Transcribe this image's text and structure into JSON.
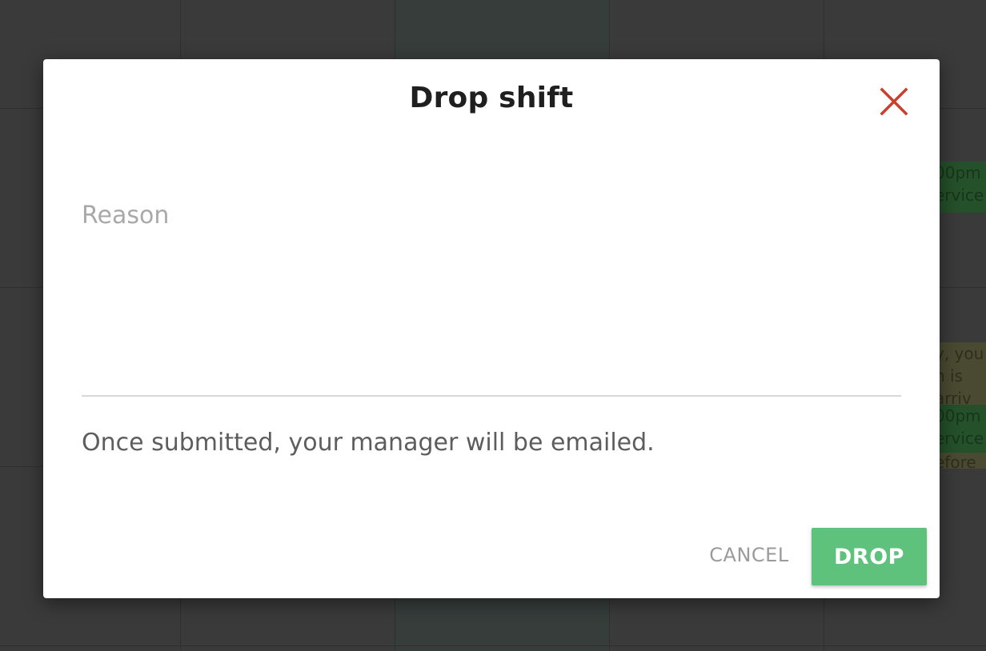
{
  "background": {
    "shift_1_time": "00pm",
    "shift_1_label": "ervice",
    "note_line_1": "y, you",
    "note_line_2": "n is",
    "note_line_3": "arriv",
    "shift_2_time": "00pm",
    "shift_2_label": "ervice",
    "note_line_4": "efore"
  },
  "modal": {
    "title": "Drop shift",
    "close_icon": "close-x-icon",
    "reason_placeholder": "Reason",
    "reason_value": "",
    "notice": "Once submitted, your manager will be emailed.",
    "cancel_label": "CANCEL",
    "drop_label": "DROP"
  },
  "colors": {
    "accent_green": "#5ec27c",
    "close_red": "#c9402d",
    "overlay": "#3a3a3a"
  }
}
